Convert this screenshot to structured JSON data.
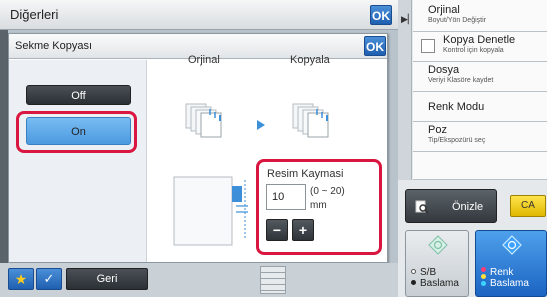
{
  "topbar": {
    "title": "Diğerleri",
    "ok_label": "OK"
  },
  "dialog": {
    "title": "Sekme Kopyası",
    "ok_label": "OK",
    "toggle": {
      "off_label": "Off",
      "on_label": "On",
      "selected": "On"
    },
    "preview": {
      "original_label": "Orjinal",
      "copy_label": "Kopyala"
    },
    "image_shift": {
      "title": "Resim Kaymasi",
      "value": "10",
      "range": "(0 ~ 20)",
      "unit": "mm",
      "minus_label": "−",
      "plus_label": "+"
    }
  },
  "right_panel": {
    "items": [
      {
        "label": "Orjinal",
        "sub": "Boyut/Yön Değiştir"
      },
      {
        "label": "Kopya Denetle",
        "sub": "Kontrol için kopyala"
      },
      {
        "label": "Dosya",
        "sub": "Veriyi Klasöre kaydet"
      },
      {
        "label": "Renk Modu",
        "sub": ""
      },
      {
        "label": "Poz",
        "sub": "Tip/Ekspozürü seç"
      }
    ],
    "preview_label": "Önizle",
    "clear_all_label": "CA",
    "bw_start": {
      "line1": "S/B",
      "line2": "Baslama"
    },
    "color_start": {
      "line1": "Renk",
      "line2": "Baslama"
    }
  },
  "bottombar": {
    "back_label": "Geri",
    "star_label": "★",
    "check_label": "✓"
  },
  "colors": {
    "highlight": "#d9163f",
    "ok_blue": "#1f5fb0",
    "on_blue": "#4c9ae0",
    "start_blue": "#1b64c2",
    "ca_yellow": "#e0b800"
  }
}
